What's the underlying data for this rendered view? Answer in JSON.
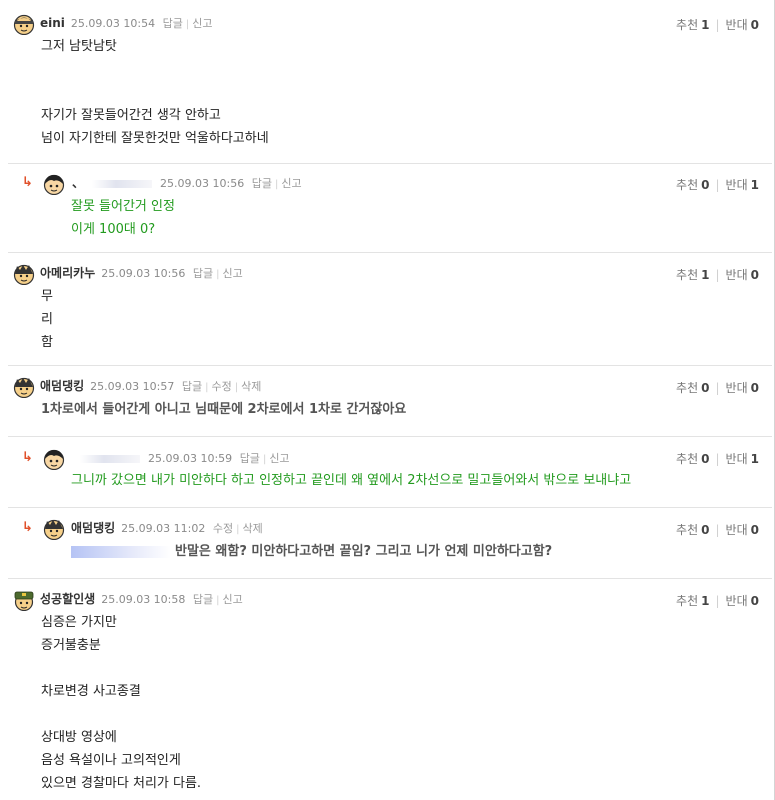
{
  "comments": [
    {
      "nick": "eini",
      "date": "25.09.03 10:54",
      "actions": [
        "답글",
        "신고"
      ],
      "vote_label": "추천",
      "vote": "1",
      "oppose_label": "반대",
      "oppose": "0",
      "lines": [
        "그저 남탓남탓",
        "",
        "",
        "자기가 잘못들어간건 생각 안하고",
        "넘이 자기한테 잘못한것만 억울하다고하네"
      ]
    },
    {
      "nick": "、",
      "date": "25.09.03 10:56",
      "actions": [
        "답글",
        "신고"
      ],
      "vote_label": "추천",
      "vote": "0",
      "oppose_label": "반대",
      "oppose": "1",
      "lines": [
        "잘못 들어간거 인정",
        "이게 100대 0?"
      ]
    },
    {
      "nick": "아메리카누",
      "date": "25.09.03 10:56",
      "actions": [
        "답글",
        "신고"
      ],
      "vote_label": "추천",
      "vote": "1",
      "oppose_label": "반대",
      "oppose": "0",
      "lines": [
        "무",
        "리",
        "함"
      ]
    },
    {
      "nick": "애덤댕킹",
      "date": "25.09.03 10:57",
      "actions": [
        "답글",
        "수정",
        "삭제"
      ],
      "vote_label": "추천",
      "vote": "0",
      "oppose_label": "반대",
      "oppose": "0",
      "lines": [
        "1차로에서 들어간게 아니고 님때문에 2차로에서 1차로 간거잖아요"
      ]
    },
    {
      "nick": "",
      "date": "25.09.03 10:59",
      "actions": [
        "답글",
        "신고"
      ],
      "vote_label": "추천",
      "vote": "0",
      "oppose_label": "반대",
      "oppose": "1",
      "lines": [
        "그니까 갔으면 내가 미안하다 하고 인정하고 끝인데 왜 옆에서 2차선으로 밀고들어와서 밖으로 보내냐고"
      ]
    },
    {
      "nick": "애덤댕킹",
      "date": "25.09.03 11:02",
      "actions": [
        "수정",
        "삭제"
      ],
      "vote_label": "추천",
      "vote": "0",
      "oppose_label": "반대",
      "oppose": "0",
      "lines": [
        "반말은 왜함? 미안하다고하면 끝임? 그리고 니가 언제 미안하다고함?"
      ]
    },
    {
      "nick": "성공할인생",
      "date": "25.09.03 10:58",
      "actions": [
        "답글",
        "신고"
      ],
      "vote_label": "추천",
      "vote": "1",
      "oppose_label": "반대",
      "oppose": "0",
      "lines": [
        "심증은 가지만",
        "증거불충분",
        "",
        "차로변경 사고종결",
        "",
        "상대방 영상에",
        "음성 욕설이나 고의적인게",
        "있으면 경찰마다 처리가 다름."
      ]
    }
  ],
  "colors": {
    "reply_green": "#239b1f",
    "reply_arrow": "#e0502a"
  },
  "icons": {
    "reply_arrow": "↳"
  }
}
